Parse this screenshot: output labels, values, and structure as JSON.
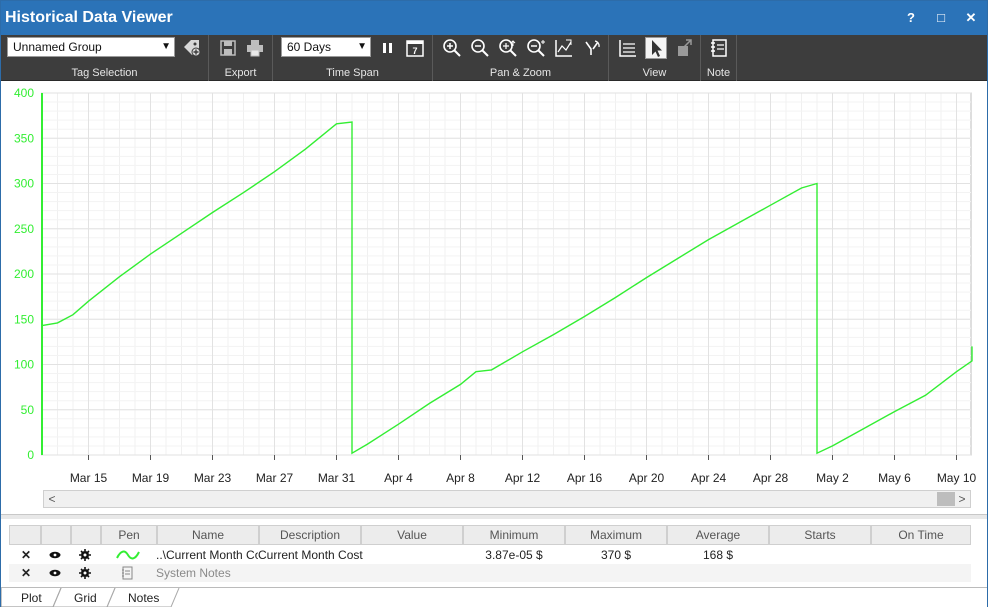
{
  "window": {
    "title": "Historical Data Viewer",
    "buttons": {
      "help": "?",
      "maximize": "□",
      "close": "✕"
    }
  },
  "ribbon": {
    "tag_selection": {
      "combo_value": "Unnamed Group",
      "label": "Tag Selection"
    },
    "export": {
      "label": "Export"
    },
    "time_span": {
      "combo_value": "60 Days",
      "label": "Time Span",
      "calendar_day": "7"
    },
    "pan_zoom": {
      "label": "Pan & Zoom"
    },
    "view": {
      "label": "View"
    },
    "note": {
      "label": "Note"
    }
  },
  "chart_data": {
    "type": "line",
    "title": "",
    "xlabel": "",
    "ylabel": "",
    "ylim": [
      0,
      400
    ],
    "yticks": [
      "0",
      "50",
      "100",
      "150",
      "200",
      "250",
      "300",
      "350",
      "400"
    ],
    "xticks": [
      "Mar 15",
      "Mar 19",
      "Mar 23",
      "Mar 27",
      "Mar 31",
      "Apr 4",
      "Apr 8",
      "Apr 12",
      "Apr 16",
      "Apr 20",
      "Apr 24",
      "Apr 28",
      "May 2",
      "May 6",
      "May 10"
    ],
    "x_start_label": "Mar 12",
    "grid": true,
    "series": [
      {
        "color": "#33ee33",
        "points": [
          [
            "Mar 12",
            143
          ],
          [
            "Mar 13",
            146
          ],
          [
            "Mar 14",
            155
          ],
          [
            "Mar 15",
            170
          ],
          [
            "Mar 17",
            197
          ],
          [
            "Mar 19",
            222
          ],
          [
            "Mar 21",
            245
          ],
          [
            "Mar 23",
            268
          ],
          [
            "Mar 25",
            290
          ],
          [
            "Mar 27",
            313
          ],
          [
            "Mar 29",
            338
          ],
          [
            "Mar 30",
            352
          ],
          [
            "Mar 31",
            366
          ],
          [
            "Apr 1",
            368
          ],
          [
            "Apr 1",
            2
          ],
          [
            "Apr 2",
            12
          ],
          [
            "Apr 4",
            34
          ],
          [
            "Apr 6",
            57
          ],
          [
            "Apr 8",
            78
          ],
          [
            "Apr 9",
            92
          ],
          [
            "Apr 10",
            94
          ],
          [
            "Apr 12",
            114
          ],
          [
            "Apr 14",
            133
          ],
          [
            "Apr 16",
            153
          ],
          [
            "Apr 18",
            174
          ],
          [
            "Apr 20",
            196
          ],
          [
            "Apr 22",
            217
          ],
          [
            "Apr 24",
            238
          ],
          [
            "Apr 26",
            257
          ],
          [
            "Apr 28",
            276
          ],
          [
            "Apr 30",
            295
          ],
          [
            "May 1",
            300
          ],
          [
            "May 1",
            2
          ],
          [
            "May 2",
            10
          ],
          [
            "May 4",
            29
          ],
          [
            "May 6",
            48
          ],
          [
            "May 8",
            66
          ],
          [
            "May 10",
            92
          ],
          [
            "May 11",
            104
          ],
          [
            "May 11",
            120
          ]
        ]
      }
    ]
  },
  "grid": {
    "headers": [
      "",
      "",
      "",
      "Pen",
      "Name",
      "Description",
      "Value",
      "Minimum",
      "Maximum",
      "Average",
      "Starts",
      "On Time"
    ],
    "rows": [
      {
        "name": "..\\Current Month Cost",
        "description": "Current Month Cost",
        "value": "",
        "minimum": "3.87e-05 $",
        "maximum": "370 $",
        "average": "168 $",
        "starts": "",
        "on_time": ""
      },
      {
        "name": "System Notes",
        "description": "",
        "value": "",
        "minimum": "",
        "maximum": "",
        "average": "",
        "starts": "",
        "on_time": ""
      }
    ]
  },
  "tabs": [
    "Plot",
    "Grid",
    "Notes"
  ],
  "colors": {
    "titlebar": "#2b73b8",
    "ribbon": "#3d3d3d",
    "axis_text": "#33ee33",
    "trend": "#33ee33"
  }
}
